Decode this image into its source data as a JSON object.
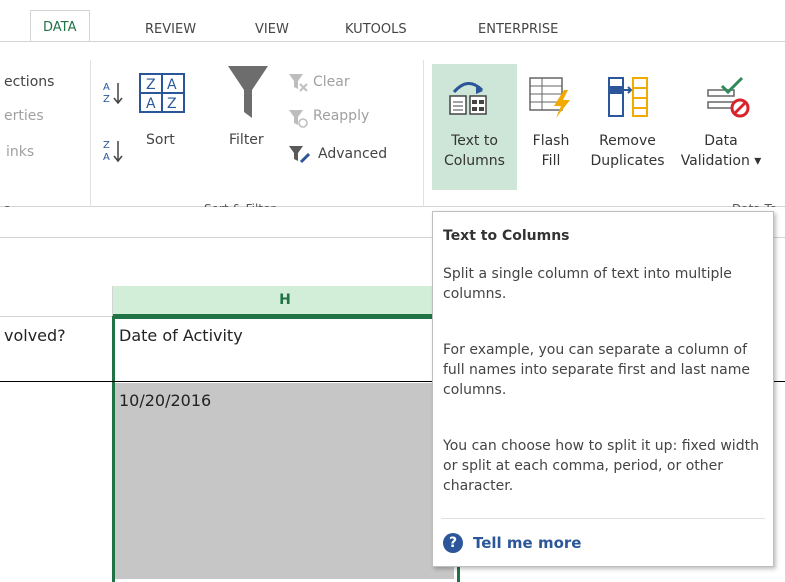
{
  "tabs": [
    {
      "label": "DATA",
      "active": true
    },
    {
      "label": "REVIEW"
    },
    {
      "label": "VIEW"
    },
    {
      "label": "KUTOOLS"
    },
    {
      "label": "ENTERPRISE"
    }
  ],
  "connections_group": {
    "items": [
      "ections",
      "erties",
      "inks"
    ],
    "label": "s"
  },
  "sort_filter_group": {
    "sort_label": "Sort",
    "filter_label": "Filter",
    "clear_label": "Clear",
    "reapply_label": "Reapply",
    "advanced_label": "Advanced",
    "label": "Sort & Filter"
  },
  "data_tools_group": {
    "text_to_columns": {
      "line1": "Text to",
      "line2": "Columns"
    },
    "flash_fill": {
      "line1": "Flash",
      "line2": "Fill"
    },
    "remove_duplicates": {
      "line1": "Remove",
      "line2": "Duplicates"
    },
    "data_validation": {
      "line1": "Data",
      "line2": "Validation ▾"
    },
    "label": "Data To"
  },
  "grid": {
    "column_header": "H",
    "left_header_cell": "volved?",
    "header_cell": "Date of Activity",
    "value_cell": "10/20/2016"
  },
  "tooltip": {
    "title": "Text to Columns",
    "para1": "Split a single column of text into multiple columns.",
    "para2": "For example, you can separate a column of full names into separate first and last name columns.",
    "para3": "You can choose how to split it up: fixed width or split at each comma, period, or other character.",
    "tell_more": "Tell me more"
  },
  "colors": {
    "accent": "#217346",
    "highlight": "#cde6d7",
    "link": "#2b579a"
  }
}
